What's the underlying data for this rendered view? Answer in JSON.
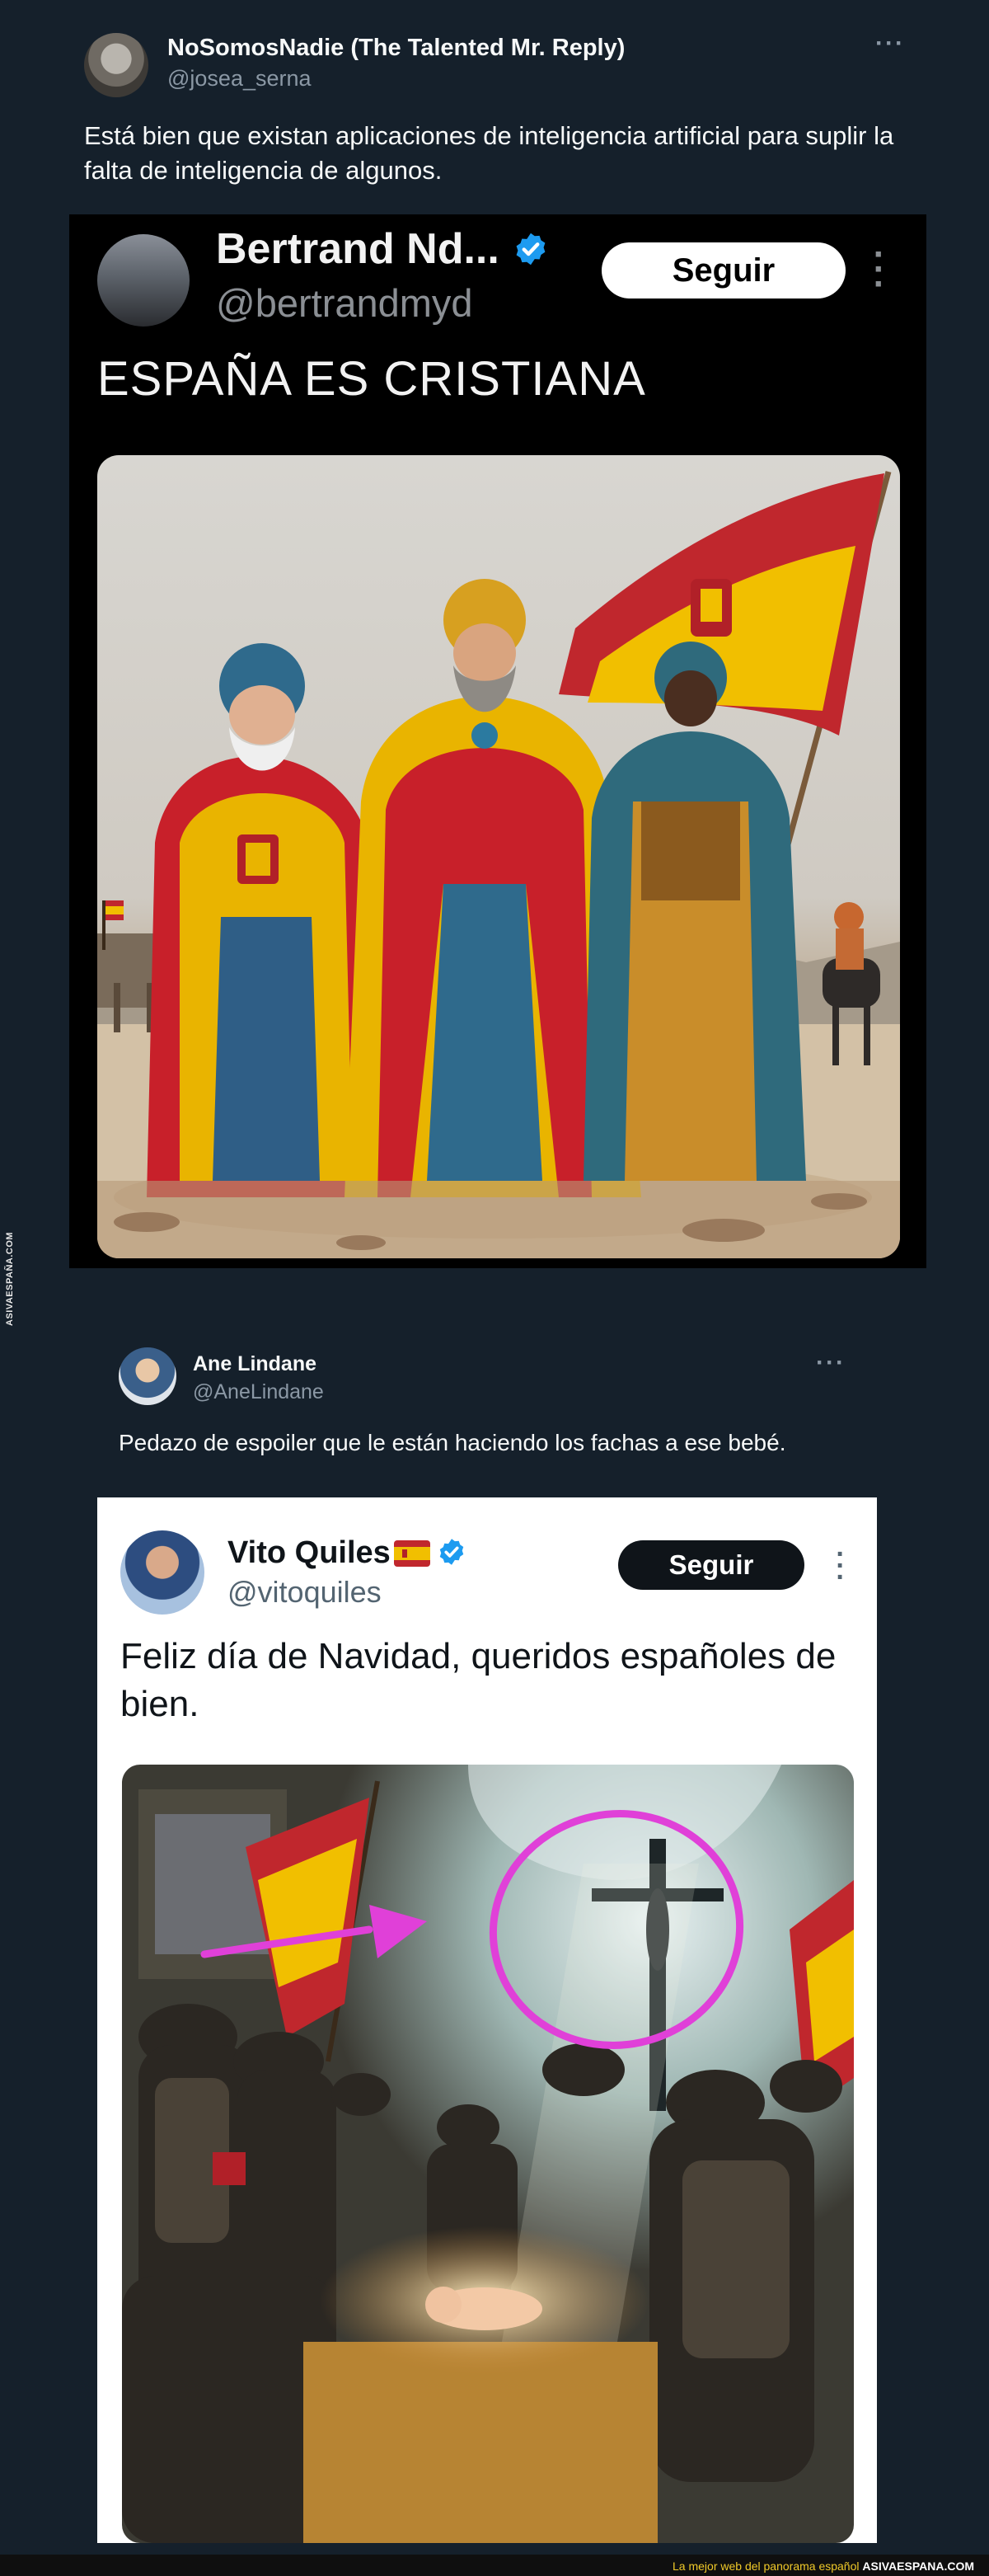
{
  "tweet1": {
    "author_name": "NoSomosNadie (The Talented Mr. Reply)",
    "author_handle": "@josea_serna",
    "text": "Está bien que existan aplicaciones de inteligencia artificial para suplir la falta de inteligencia de algunos.",
    "menu_icon": "more-horizontal-icon",
    "quoted": {
      "author_name": "Bertrand Nd...",
      "author_handle": "@bertrandmyd",
      "verified": true,
      "follow_label": "Seguir",
      "text": "ESPAÑA ES CRISTIANA",
      "menu_icon": "more-vertical-icon"
    }
  },
  "tweet2": {
    "author_name": "Ane Lindane",
    "author_handle": "@AneLindane",
    "text": "Pedazo de espoiler que le están haciendo los fachas a ese bebé.",
    "menu_icon": "more-horizontal-icon",
    "quoted": {
      "author_name": "Vito Quiles",
      "author_handle": "@vitoquiles",
      "flag_emoji": "🇪🇸",
      "verified": true,
      "follow_label": "Seguir",
      "text": "Feliz día de Navidad, queridos españoles de bien.",
      "menu_icon": "more-vertical-icon"
    }
  },
  "watermark": "ASIVAESPAÑA.COM",
  "footer": {
    "tagline": "La mejor web del panorama español",
    "site": "ASIVAESPANA.COM"
  },
  "colors": {
    "background": "#15202b",
    "verified_blue": "#1d9bf0",
    "annotation_magenta": "#e040d8",
    "footer_yellow": "#f0c929"
  }
}
